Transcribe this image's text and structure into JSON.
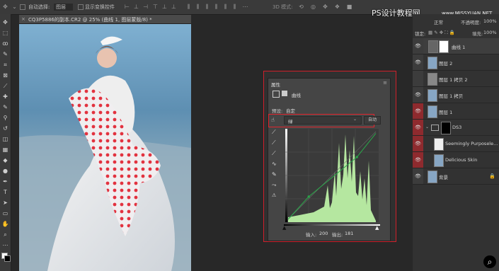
{
  "options_bar": {
    "auto_select_label": "自动选择:",
    "auto_select_value": "图层",
    "show_transform_label": "显示变换控件",
    "mode_3d": "3D 模式:"
  },
  "document": {
    "tab_title": "CQ3P5886的副本.CR2 @ 25% (曲线 1, 图层蒙版/8) *"
  },
  "watermark": {
    "text": "PS设计教程网",
    "url": "www.MISSYUAN.NET"
  },
  "layers_panel": {
    "blend_mode": "正常",
    "opacity_label": "不透明度:",
    "opacity_value": "100%",
    "lock_label": "锁定:",
    "fill_label": "填充:",
    "fill_value": "100%",
    "layers": [
      {
        "name": "曲线 1"
      },
      {
        "name": "图层 2"
      },
      {
        "name": "图层 1 拷贝 2"
      },
      {
        "name": "图层 1 拷贝"
      },
      {
        "name": "图层 1"
      },
      {
        "name": "DS3"
      },
      {
        "name": "Seemingly Purposele..."
      },
      {
        "name": "Delicious Skin"
      },
      {
        "name": "背景"
      }
    ]
  },
  "properties_panel": {
    "tab_label": "属性",
    "adjustment_label": "曲线",
    "preset_label": "预设:",
    "preset_value": "自定",
    "channel_value": "绿",
    "auto_button": "自动",
    "input_label": "输入:",
    "input_value": "200",
    "output_label": "输出:",
    "output_value": "181"
  },
  "curve": {
    "points": [
      [
        0,
        0
      ],
      [
        60,
        66
      ],
      [
        200,
        181
      ],
      [
        255,
        250
      ]
    ]
  }
}
